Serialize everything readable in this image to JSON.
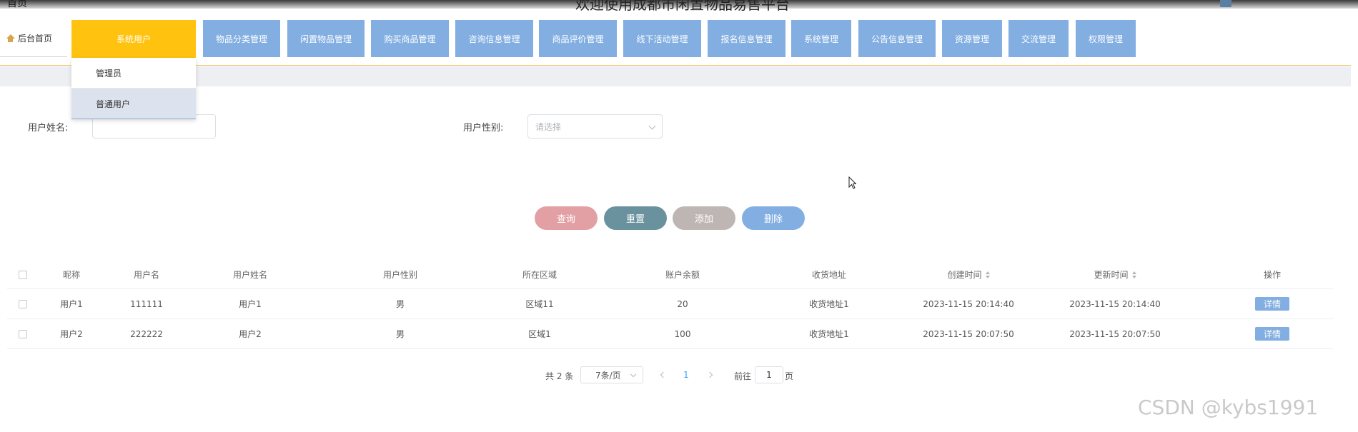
{
  "header": {
    "breadcrumb": "首页",
    "title": "欢迎使用成都市闲置物品易售平台"
  },
  "nav": {
    "home": "后台首页",
    "items": [
      {
        "label": "系统用户",
        "active": true
      },
      {
        "label": "物品分类管理"
      },
      {
        "label": "闲置物品管理"
      },
      {
        "label": "购买商品管理"
      },
      {
        "label": "咨询信息管理"
      },
      {
        "label": "商品评价管理"
      },
      {
        "label": "线下活动管理"
      },
      {
        "label": "报名信息管理"
      },
      {
        "label": "系统管理"
      },
      {
        "label": "公告信息管理"
      },
      {
        "label": "资源管理"
      },
      {
        "label": "交流管理"
      },
      {
        "label": "权限管理"
      }
    ],
    "dropdown": [
      "管理员",
      "普通用户"
    ]
  },
  "search": {
    "name_label": "用户姓名:",
    "name_value": "",
    "gender_label": "用户性别:",
    "gender_placeholder": "请选择"
  },
  "actions": {
    "query": "查询",
    "reset": "重置",
    "add": "添加",
    "delete": "删除"
  },
  "table": {
    "columns": [
      "昵称",
      "用户名",
      "用户姓名",
      "用户性别",
      "所在区域",
      "账户余额",
      "收货地址",
      "创建时间",
      "更新时间",
      "操作"
    ],
    "rows": [
      {
        "nickname": "用户1",
        "username": "111111",
        "realname": "用户1",
        "gender": "男",
        "region": "区域11",
        "balance": "20",
        "address": "收货地址1",
        "created": "2023-11-15 20:14:40",
        "updated": "2023-11-15 20:14:40",
        "action": "详情"
      },
      {
        "nickname": "用户2",
        "username": "222222",
        "realname": "用户2",
        "gender": "男",
        "region": "区域1",
        "balance": "100",
        "address": "收货地址1",
        "created": "2023-11-15 20:07:50",
        "updated": "2023-11-15 20:07:50",
        "action": "详情"
      }
    ]
  },
  "pagination": {
    "total": "共 2 条",
    "page_size": "7条/页",
    "current": "1",
    "goto_label": "前往",
    "goto_value": "1",
    "page_suffix": "页"
  },
  "watermark": "CSDN @kybs1991",
  "colors": {
    "nav_blue": "#82aee1",
    "nav_active": "#ffc30f",
    "query_btn": "#e2a0a4",
    "reset_btn": "#6a919e",
    "add_btn": "#bdb6b3",
    "delete_btn": "#82aee1"
  }
}
